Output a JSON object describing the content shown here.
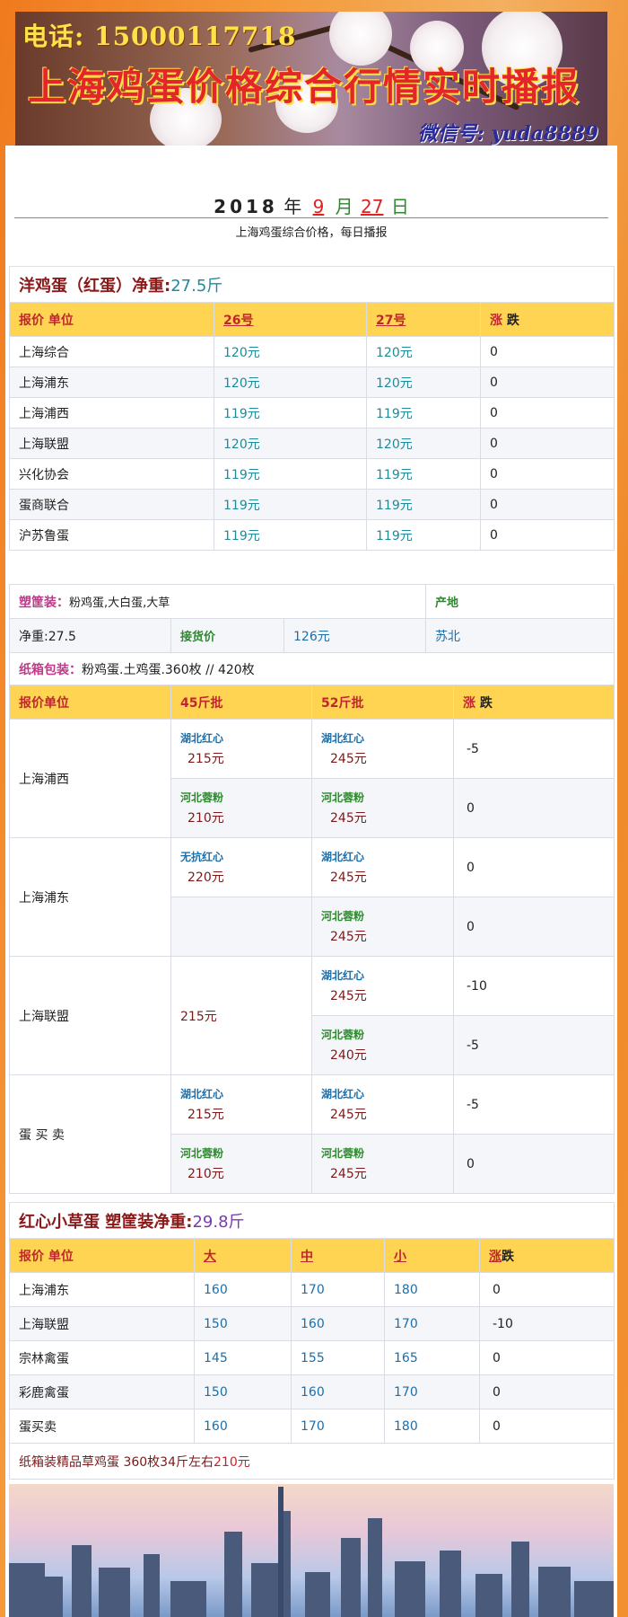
{
  "banner": {
    "phone": "电话: 15000117718",
    "headline": "上海鸡蛋价格综合行情实时播报",
    "wechat": "微信号: yuda8889"
  },
  "date": {
    "year": "2018",
    "year_unit": "年",
    "month": "9",
    "month_unit": "月",
    "day": "27",
    "day_unit": "日"
  },
  "subtitle": "上海鸡蛋综合价格，每日播报",
  "section1": {
    "title_prefix": "洋鸡蛋（红蛋）净重:",
    "title_value": "27.5斤",
    "headers": [
      "报价 单位",
      "26号",
      "27号",
      "涨",
      "跌"
    ],
    "rows": [
      {
        "unit": "上海综合",
        "d26": "120元",
        "d27": "120元",
        "chg": "0"
      },
      {
        "unit": "上海浦东",
        "d26": "120元",
        "d27": "120元",
        "chg": "0"
      },
      {
        "unit": "上海浦西",
        "d26": "119元",
        "d27": "119元",
        "chg": "0"
      },
      {
        "unit": "上海联盟",
        "d26": "120元",
        "d27": "120元",
        "chg": "0"
      },
      {
        "unit": "兴化协会",
        "d26": "119元",
        "d27": "119元",
        "chg": "0"
      },
      {
        "unit": "蛋商联合",
        "d26": "119元",
        "d27": "119元",
        "chg": "0"
      },
      {
        "unit": "沪苏鲁蛋",
        "d26": "119元",
        "d27": "119元",
        "chg": "0"
      }
    ]
  },
  "plastic": {
    "label": "塑筐装：",
    "desc": "粉鸡蛋,大白蛋,大草",
    "origin_label": "产地",
    "net": "净重:27.5",
    "pickup_label": "接货价",
    "pickup_price": "126元",
    "origin": "苏北"
  },
  "carton": {
    "label": "纸箱包装：",
    "desc": "粉鸡蛋.土鸡蛋.360枚 // 420枚",
    "headers": [
      "报价单位",
      "45斤批",
      "52斤批",
      "涨",
      "跌"
    ],
    "groups": [
      {
        "unit": "上海浦西",
        "rows": [
          {
            "l45": "湖北红心",
            "p45": "215元",
            "l52": "湖北红心",
            "p52": "245元",
            "chg": "-5"
          },
          {
            "l45": "河北蓉粉",
            "p45": "210元",
            "l52": "河北蓉粉",
            "p52": "245元",
            "chg": "0"
          }
        ]
      },
      {
        "unit": "上海浦东",
        "rows": [
          {
            "l45": "无抗红心",
            "p45": "220元",
            "l52": "湖北红心",
            "p52": "245元",
            "chg": "0"
          },
          {
            "l45": "",
            "p45": "",
            "l52": "河北蓉粉",
            "p52": "245元",
            "chg": "0"
          }
        ]
      },
      {
        "unit": "上海联盟",
        "p45_merged": "215元",
        "rows": [
          {
            "l52": "湖北红心",
            "p52": "245元",
            "chg": "-10"
          },
          {
            "l52": "河北蓉粉",
            "p52": "240元",
            "chg": "-5"
          }
        ]
      },
      {
        "unit": "蛋 买 卖",
        "rows": [
          {
            "l45": "湖北红心",
            "p45": "215元",
            "l52": "湖北红心",
            "p52": "245元",
            "chg": "-5"
          },
          {
            "l45": "河北蓉粉",
            "p45": "210元",
            "l52": "河北蓉粉",
            "p52": "245元",
            "chg": "0"
          }
        ]
      }
    ]
  },
  "section3": {
    "title_prefix": "红心小草蛋 塑筐装净重:",
    "title_value": "29.8斤",
    "headers": [
      "报价 单位",
      "大",
      "中",
      "小",
      "涨",
      "跌"
    ],
    "rows": [
      {
        "unit": "上海浦东",
        "big": "160",
        "mid": "170",
        "small": "180",
        "chg": "0"
      },
      {
        "unit": "上海联盟",
        "big": "150",
        "mid": "160",
        "small": "170",
        "chg": "-10"
      },
      {
        "unit": "宗林禽蛋",
        "big": "145",
        "mid": "155",
        "small": "165",
        "chg": "0"
      },
      {
        "unit": "彩鹿禽蛋",
        "big": "150",
        "mid": "160",
        "small": "170",
        "chg": "0"
      },
      {
        "unit": "蛋买卖",
        "big": "160",
        "mid": "170",
        "small": "180",
        "chg": "0"
      }
    ],
    "footer_prefix": "纸箱装精品草鸡蛋 360枚34斤左右",
    "footer_price": "210元"
  },
  "colors": {
    "accent_header": "#ffd452",
    "red": "#c0272d",
    "blue": "#1e6ea8",
    "background": "#f59a3a"
  }
}
